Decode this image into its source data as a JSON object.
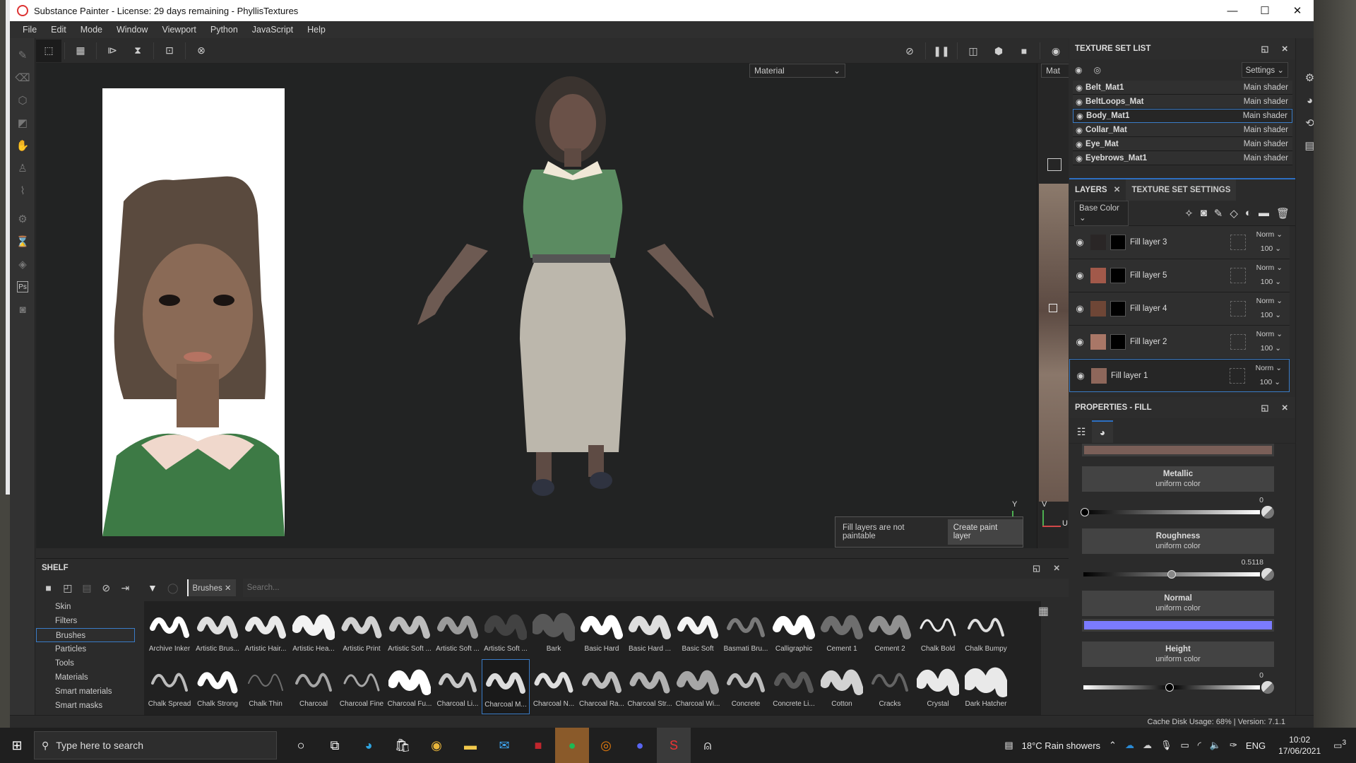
{
  "window": {
    "title": "Substance Painter - License: 29 days remaining - PhyllisTextures",
    "controls": {
      "minimize": "—",
      "maximize": "☐",
      "close": "✕"
    }
  },
  "menu": [
    "File",
    "Edit",
    "Mode",
    "Window",
    "Viewport",
    "Python",
    "JavaScript",
    "Help"
  ],
  "viewport": {
    "display_mode_2d": "Material",
    "display_mode_3d": "Mat",
    "axis_3d": "Y",
    "axis_uv_v": "V",
    "axis_uv_u": "U",
    "toast_message": "Fill layers are not paintable",
    "toast_button": "Create paint layer"
  },
  "texture_set_list": {
    "title": "TEXTURE SET LIST",
    "settings_label": "Settings",
    "items": [
      {
        "name": "Belt_Mat1",
        "shader": "Main shader",
        "selected": false
      },
      {
        "name": "BeltLoops_Mat",
        "shader": "Main shader",
        "selected": false
      },
      {
        "name": "Body_Mat1",
        "shader": "Main shader",
        "selected": true
      },
      {
        "name": "Collar_Mat",
        "shader": "Main shader",
        "selected": false
      },
      {
        "name": "Eye_Mat",
        "shader": "Main shader",
        "selected": false
      },
      {
        "name": "Eyebrows_Mat1",
        "shader": "Main shader",
        "selected": false
      }
    ]
  },
  "layers": {
    "tab_layers": "LAYERS",
    "tab_tss": "TEXTURE SET SETTINGS",
    "channel": "Base Color",
    "items": [
      {
        "name": "Fill layer 3",
        "blend": "Norm",
        "opacity": "100",
        "color": "#2a2626",
        "selected": false
      },
      {
        "name": "Fill layer 5",
        "blend": "Norm",
        "opacity": "100",
        "color": "#a2594a",
        "selected": false
      },
      {
        "name": "Fill layer 4",
        "blend": "Norm",
        "opacity": "100",
        "color": "#6e4636",
        "selected": false
      },
      {
        "name": "Fill layer 2",
        "blend": "Norm",
        "opacity": "100",
        "color": "#a97767",
        "selected": false
      },
      {
        "name": "Fill layer 1",
        "blend": "Norm",
        "opacity": "100",
        "color": "#8e675b",
        "selected": true
      }
    ]
  },
  "properties": {
    "title": "PROPERTIES - FILL",
    "base_color": "#7a5f58",
    "channels": [
      {
        "name": "Metallic",
        "mode": "uniform color",
        "value": "0",
        "fraction": 0.0
      },
      {
        "name": "Roughness",
        "mode": "uniform color",
        "value": "0.5118",
        "fraction": 0.5118
      },
      {
        "name": "Normal",
        "mode": "uniform color",
        "color": "#7b7bff"
      },
      {
        "name": "Height",
        "mode": "uniform color",
        "value": "0",
        "fraction": 0.5
      }
    ]
  },
  "shelf": {
    "title": "SHELF",
    "categories": [
      "Skin",
      "Filters",
      "Brushes",
      "Particles",
      "Tools",
      "Materials",
      "Smart materials",
      "Smart masks"
    ],
    "selected_category": "Brushes",
    "filter_chip": "Brushes",
    "search_placeholder": "Search...",
    "brushes_row1": [
      "Archive Inker",
      "Artistic Brus...",
      "Artistic Hair...",
      "Artistic Hea...",
      "Artistic Print",
      "Artistic Soft ...",
      "Artistic Soft ...",
      "Artistic Soft ...",
      "Bark",
      "Basic Hard",
      "Basic Hard ...",
      "Basic Soft",
      "Basmati Bru...",
      "Calligraphic",
      "Cement 1",
      "Cement 2",
      "Chalk Bold",
      "Chalk Bumpy"
    ],
    "brushes_row2": [
      "Chalk Spread",
      "Chalk Strong",
      "Chalk Thin",
      "Charcoal",
      "Charcoal Fine",
      "Charcoal Fu...",
      "Charcoal Li...",
      "Charcoal M...",
      "Charcoal N...",
      "Charcoal Ra...",
      "Charcoal Str...",
      "Charcoal Wi...",
      "Concrete",
      "Concrete Li...",
      "Cotton",
      "Cracks",
      "Crystal",
      "Dark Hatcher"
    ],
    "selected_brush": "Charcoal M..."
  },
  "status": {
    "text": "Cache Disk Usage:   68% | Version: 7.1.1"
  },
  "taskbar": {
    "search_placeholder": "Type here to search",
    "weather": "18°C  Rain showers",
    "language": "ENG",
    "time": "10:02",
    "date": "17/06/2021",
    "notifications": "3"
  }
}
